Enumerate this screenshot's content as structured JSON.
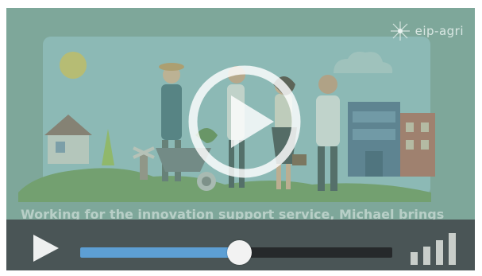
{
  "video": {
    "logo_text": "eip-agri",
    "caption": "Working for the innovation support service, Michael brings",
    "progress": 0.51
  },
  "controls": {
    "play_icon": "play-icon",
    "volume_icon": "volume-bars-icon",
    "big_play_icon": "play-circle-icon"
  },
  "colors": {
    "progress_fill": "#5d9fd4",
    "track": "#26292b",
    "control_bar": "#4a5556",
    "overlay": "#7fa79a"
  }
}
